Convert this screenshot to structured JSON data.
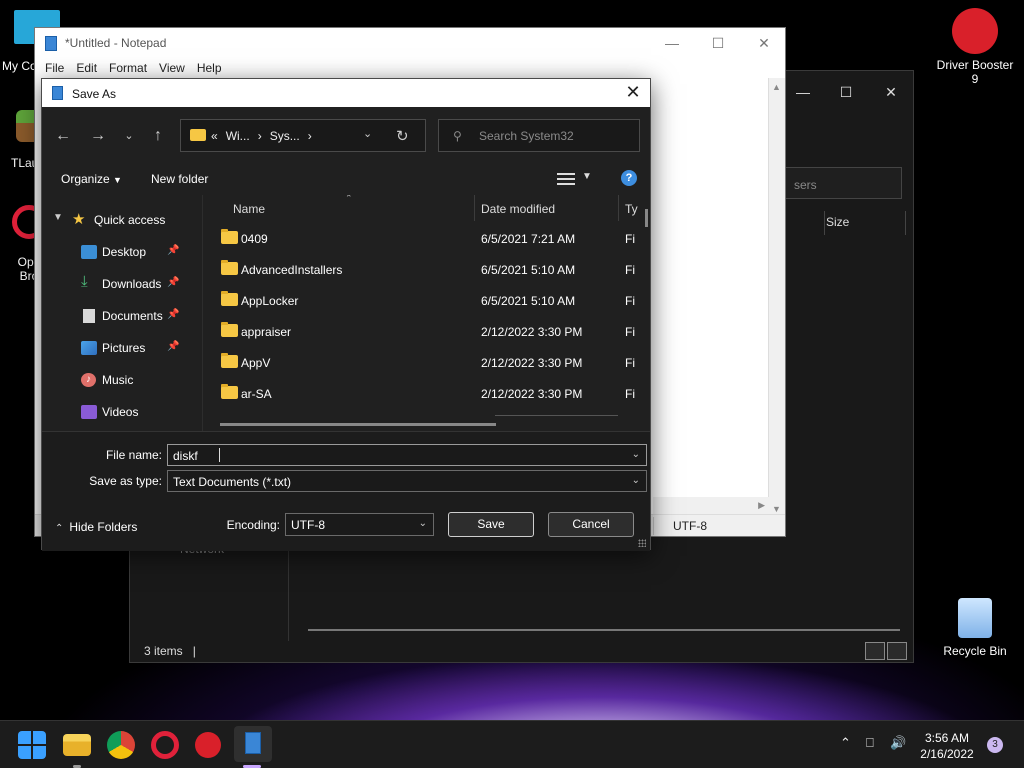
{
  "desktop": {
    "icons": [
      {
        "label": "My Co"
      },
      {
        "label": "TLau"
      },
      {
        "label": "Ope Bro"
      },
      {
        "label": "Driver Booster 9"
      },
      {
        "label": "Recycle Bin"
      }
    ]
  },
  "explorer_bg": {
    "search_placeholder": "sers",
    "size_column": "Size",
    "network_label": "Network",
    "status": "3 items"
  },
  "notepad": {
    "title": "*Untitled - Notepad",
    "menu": [
      "File",
      "Edit",
      "Format",
      "View",
      "Help"
    ],
    "encoding": "UTF-8"
  },
  "dialog": {
    "title": "Save As",
    "breadcrumbs": [
      "«",
      "Wi...",
      "›",
      "Sys...",
      "›"
    ],
    "search_placeholder": "Search System32",
    "organize": "Organize",
    "new_folder": "New folder",
    "nav": [
      {
        "label": "Quick access",
        "pinned": false
      },
      {
        "label": "Desktop",
        "pinned": true
      },
      {
        "label": "Downloads",
        "pinned": true
      },
      {
        "label": "Documents",
        "pinned": true
      },
      {
        "label": "Pictures",
        "pinned": true
      },
      {
        "label": "Music",
        "pinned": false
      },
      {
        "label": "Videos",
        "pinned": false
      }
    ],
    "columns": {
      "name": "Name",
      "date": "Date modified",
      "type": "Ty"
    },
    "files": [
      {
        "name": "0409",
        "date": "6/5/2021 7:21 AM",
        "type": "Fi"
      },
      {
        "name": "AdvancedInstallers",
        "date": "6/5/2021 5:10 AM",
        "type": "Fi"
      },
      {
        "name": "AppLocker",
        "date": "6/5/2021 5:10 AM",
        "type": "Fi"
      },
      {
        "name": "appraiser",
        "date": "2/12/2022 3:30 PM",
        "type": "Fi"
      },
      {
        "name": "AppV",
        "date": "2/12/2022 3:30 PM",
        "type": "Fi"
      },
      {
        "name": "ar-SA",
        "date": "2/12/2022 3:30 PM",
        "type": "Fi"
      }
    ],
    "file_name_label": "File name:",
    "file_name_value": "diskf",
    "save_type_label": "Save as type:",
    "save_type_value": "Text Documents (*.txt)",
    "hide_folders": "Hide Folders",
    "encoding_label": "Encoding:",
    "encoding_value": "UTF-8",
    "save_button": "Save",
    "cancel_button": "Cancel"
  },
  "taskbar": {
    "time": "3:56 AM",
    "date": "2/16/2022",
    "notifications": "3"
  },
  "colors": {
    "folder": "#f6c744",
    "accent": "#3d8ee0",
    "dialog_bg": "#202020"
  }
}
